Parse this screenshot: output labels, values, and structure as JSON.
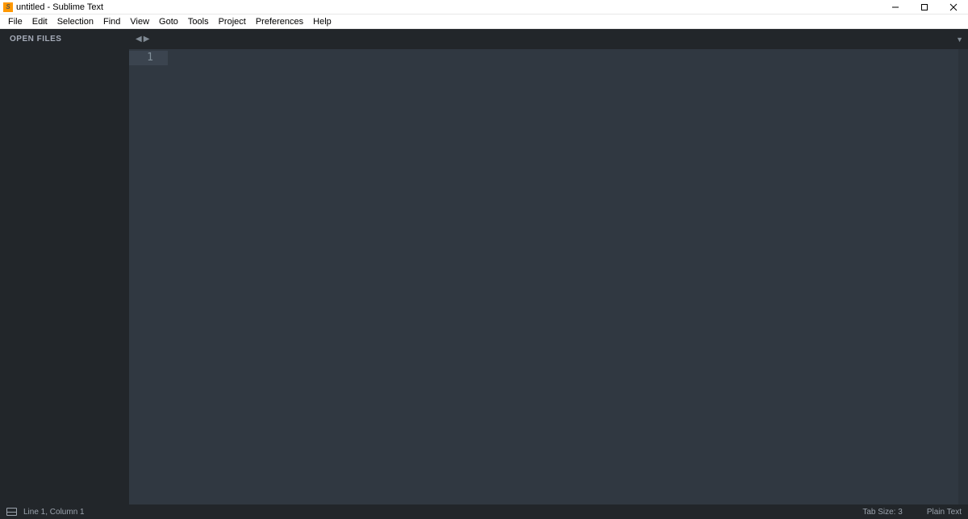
{
  "titlebar": {
    "title": "untitled - Sublime Text"
  },
  "menubar": {
    "items": [
      "File",
      "Edit",
      "Selection",
      "Find",
      "View",
      "Goto",
      "Tools",
      "Project",
      "Preferences",
      "Help"
    ]
  },
  "sidebar": {
    "header": "OPEN FILES"
  },
  "editor": {
    "line_number": "1"
  },
  "statusbar": {
    "position": "Line 1, Column 1",
    "tab_size": "Tab Size: 3",
    "syntax": "Plain Text"
  }
}
